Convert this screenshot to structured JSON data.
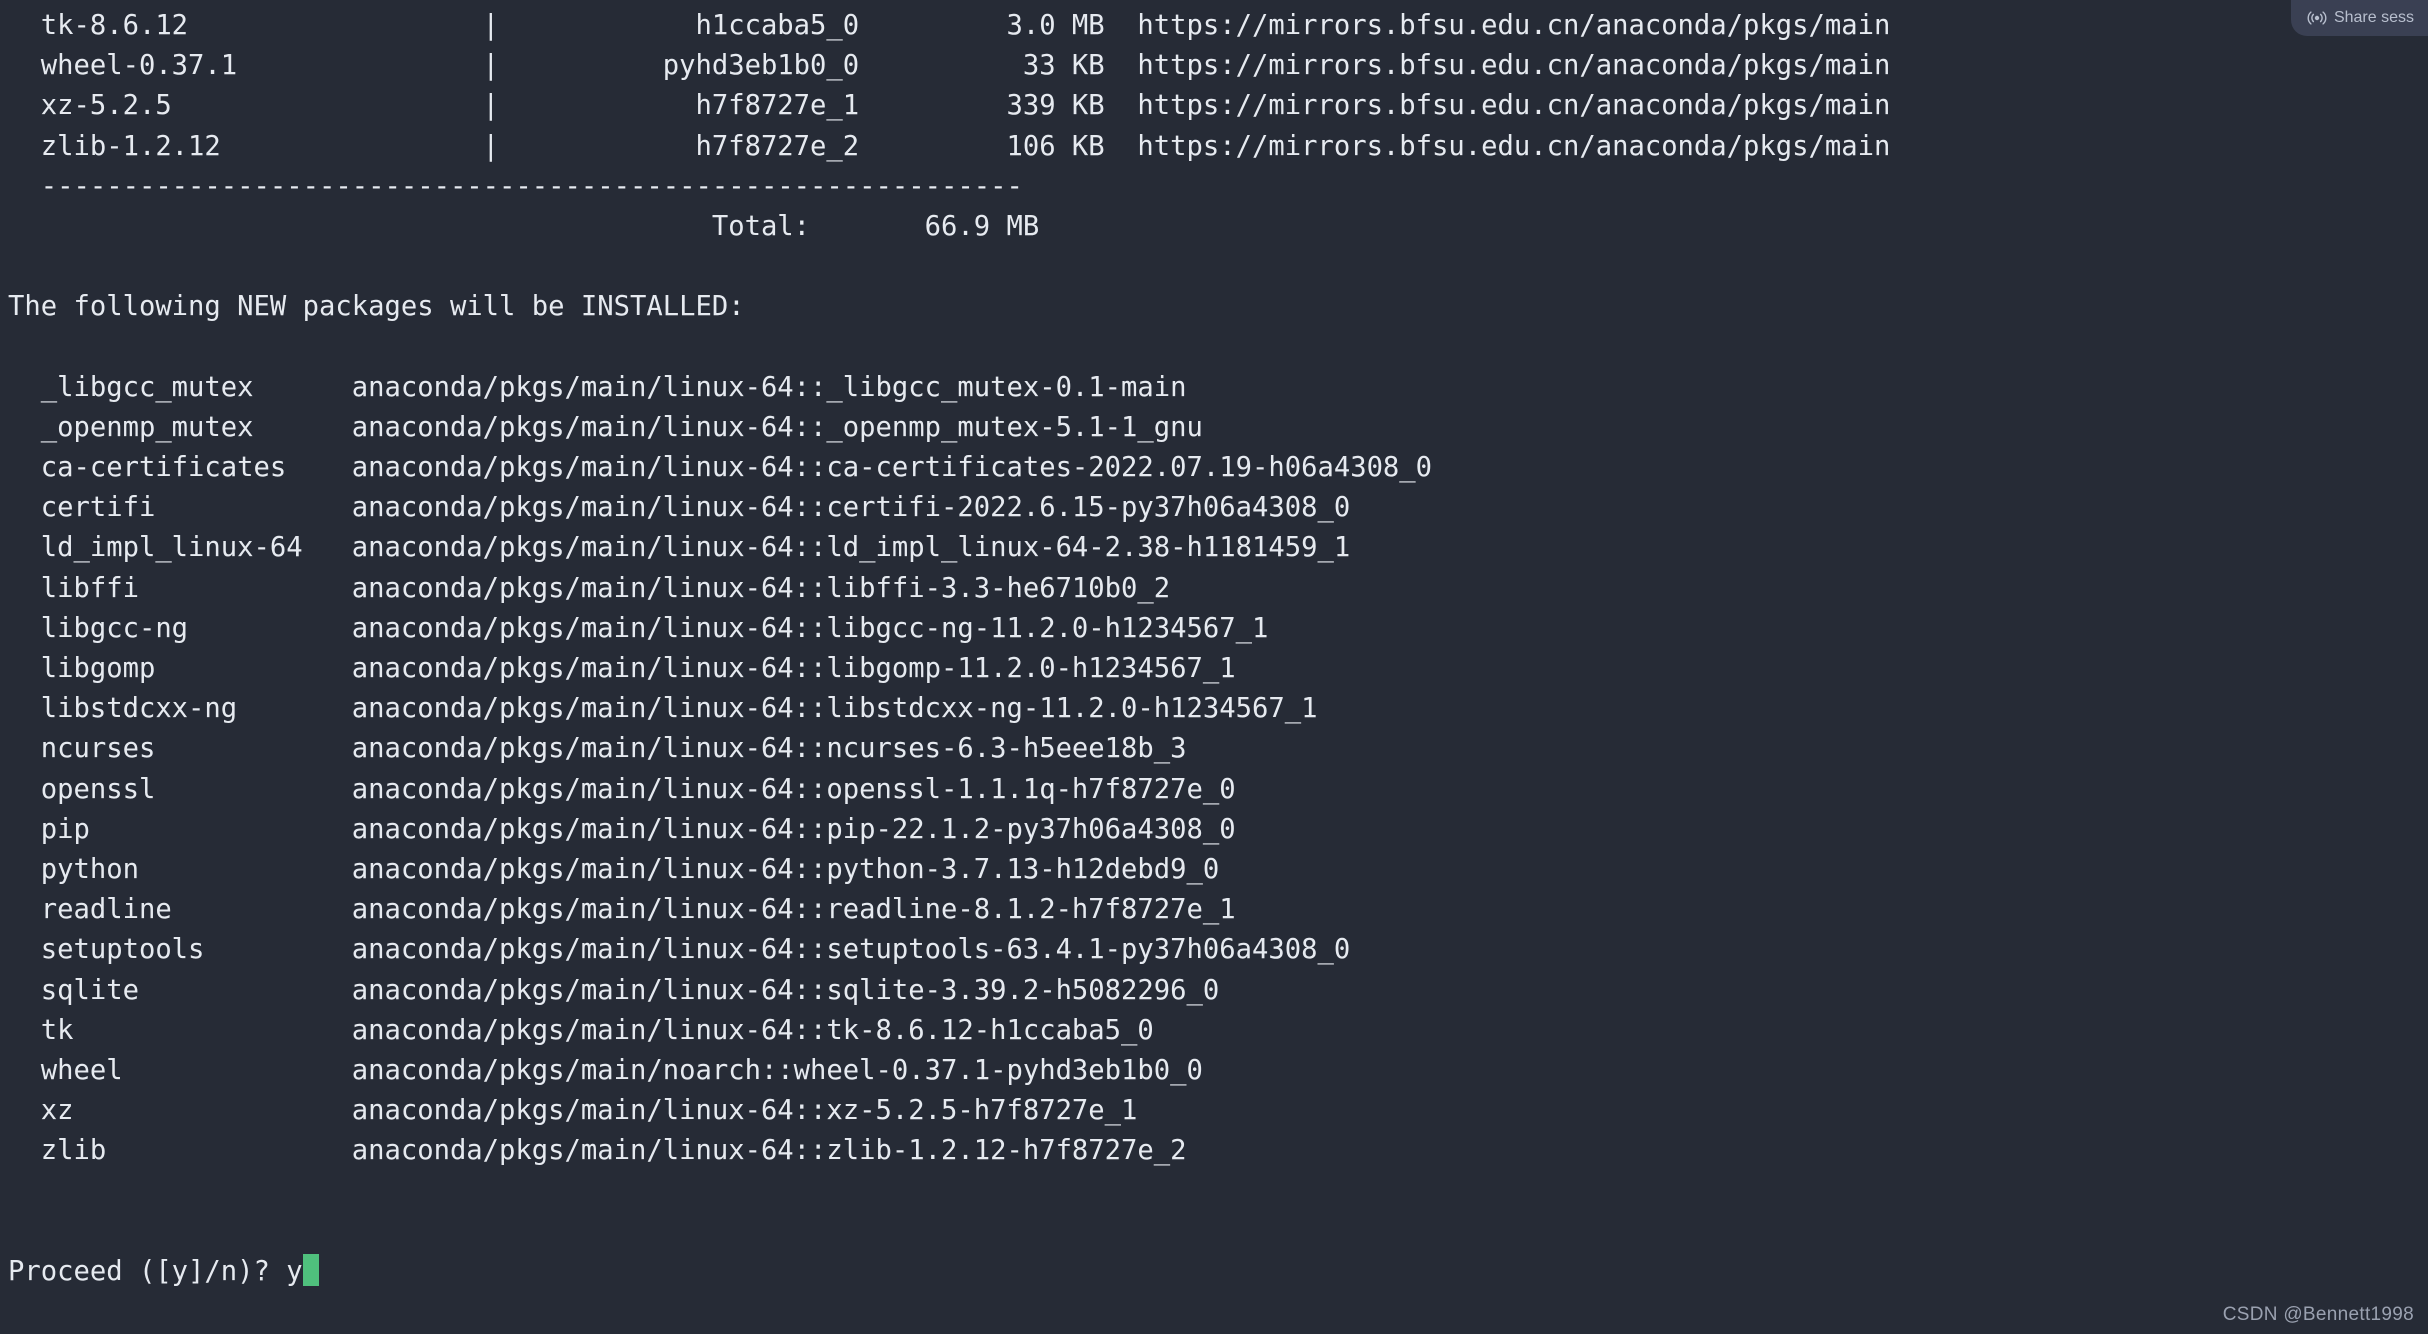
{
  "terminal": {
    "background_color": "#262b36",
    "text_color": "#e6eaf0",
    "cursor_color": "#4fc07d",
    "download_table": {
      "rows": [
        {
          "package": "  tk-8.6.12",
          "sep": "|",
          "build": "h1ccaba5_0",
          "size": "3.0 MB",
          "url": "https://mirrors.bfsu.edu.cn/anaconda/pkgs/main"
        },
        {
          "package": "  wheel-0.37.1",
          "sep": "|",
          "build": "pyhd3eb1b0_0",
          "size": "33 KB",
          "url": "https://mirrors.bfsu.edu.cn/anaconda/pkgs/main"
        },
        {
          "package": "  xz-5.2.5",
          "sep": "|",
          "build": "h7f8727e_1",
          "size": "339 KB",
          "url": "https://mirrors.bfsu.edu.cn/anaconda/pkgs/main"
        },
        {
          "package": "  zlib-1.2.12",
          "sep": "|",
          "build": "h7f8727e_2",
          "size": "106 KB",
          "url": "https://mirrors.bfsu.edu.cn/anaconda/pkgs/main"
        }
      ],
      "line_tk": "  tk-8.6.12                  |            h1ccaba5_0         3.0 MB  https://mirrors.bfsu.edu.cn/anaconda/pkgs/main",
      "line_wheel": "  wheel-0.37.1               |          pyhd3eb1b0_0          33 KB  https://mirrors.bfsu.edu.cn/anaconda/pkgs/main",
      "line_xz": "  xz-5.2.5                   |            h7f8727e_1         339 KB  https://mirrors.bfsu.edu.cn/anaconda/pkgs/main",
      "line_zlib": "  zlib-1.2.12                |            h7f8727e_2         106 KB  https://mirrors.bfsu.edu.cn/anaconda/pkgs/main",
      "separator": "  ------------------------------------------------------------",
      "total_line": "                                           Total:       66.9 MB",
      "total_label": "Total:",
      "total_value": "66.9 MB"
    },
    "install_header": "The following NEW packages will be INSTALLED:",
    "install_lines": [
      "  _libgcc_mutex      anaconda/pkgs/main/linux-64::_libgcc_mutex-0.1-main",
      "  _openmp_mutex      anaconda/pkgs/main/linux-64::_openmp_mutex-5.1-1_gnu",
      "  ca-certificates    anaconda/pkgs/main/linux-64::ca-certificates-2022.07.19-h06a4308_0",
      "  certifi            anaconda/pkgs/main/linux-64::certifi-2022.6.15-py37h06a4308_0",
      "  ld_impl_linux-64   anaconda/pkgs/main/linux-64::ld_impl_linux-64-2.38-h1181459_1",
      "  libffi             anaconda/pkgs/main/linux-64::libffi-3.3-he6710b0_2",
      "  libgcc-ng          anaconda/pkgs/main/linux-64::libgcc-ng-11.2.0-h1234567_1",
      "  libgomp            anaconda/pkgs/main/linux-64::libgomp-11.2.0-h1234567_1",
      "  libstdcxx-ng       anaconda/pkgs/main/linux-64::libstdcxx-ng-11.2.0-h1234567_1",
      "  ncurses            anaconda/pkgs/main/linux-64::ncurses-6.3-h5eee18b_3",
      "  openssl            anaconda/pkgs/main/linux-64::openssl-1.1.1q-h7f8727e_0",
      "  pip                anaconda/pkgs/main/linux-64::pip-22.1.2-py37h06a4308_0",
      "  python             anaconda/pkgs/main/linux-64::python-3.7.13-h12debd9_0",
      "  readline           anaconda/pkgs/main/linux-64::readline-8.1.2-h7f8727e_1",
      "  setuptools         anaconda/pkgs/main/linux-64::setuptools-63.4.1-py37h06a4308_0",
      "  sqlite             anaconda/pkgs/main/linux-64::sqlite-3.39.2-h5082296_0",
      "  tk                 anaconda/pkgs/main/linux-64::tk-8.6.12-h1ccaba5_0",
      "  wheel              anaconda/pkgs/main/noarch::wheel-0.37.1-pyhd3eb1b0_0",
      "  xz                 anaconda/pkgs/main/linux-64::xz-5.2.5-h7f8727e_1",
      "  zlib               anaconda/pkgs/main/linux-64::zlib-1.2.12-h7f8727e_2"
    ],
    "installed_packages": [
      {
        "name": "_libgcc_mutex",
        "spec": "anaconda/pkgs/main/linux-64::_libgcc_mutex-0.1-main"
      },
      {
        "name": "_openmp_mutex",
        "spec": "anaconda/pkgs/main/linux-64::_openmp_mutex-5.1-1_gnu"
      },
      {
        "name": "ca-certificates",
        "spec": "anaconda/pkgs/main/linux-64::ca-certificates-2022.07.19-h06a4308_0"
      },
      {
        "name": "certifi",
        "spec": "anaconda/pkgs/main/linux-64::certifi-2022.6.15-py37h06a4308_0"
      },
      {
        "name": "ld_impl_linux-64",
        "spec": "anaconda/pkgs/main/linux-64::ld_impl_linux-64-2.38-h1181459_1"
      },
      {
        "name": "libffi",
        "spec": "anaconda/pkgs/main/linux-64::libffi-3.3-he6710b0_2"
      },
      {
        "name": "libgcc-ng",
        "spec": "anaconda/pkgs/main/linux-64::libgcc-ng-11.2.0-h1234567_1"
      },
      {
        "name": "libgomp",
        "spec": "anaconda/pkgs/main/linux-64::libgomp-11.2.0-h1234567_1"
      },
      {
        "name": "libstdcxx-ng",
        "spec": "anaconda/pkgs/main/linux-64::libstdcxx-ng-11.2.0-h1234567_1"
      },
      {
        "name": "ncurses",
        "spec": "anaconda/pkgs/main/linux-64::ncurses-6.3-h5eee18b_3"
      },
      {
        "name": "openssl",
        "spec": "anaconda/pkgs/main/linux-64::openssl-1.1.1q-h7f8727e_0"
      },
      {
        "name": "pip",
        "spec": "anaconda/pkgs/main/linux-64::pip-22.1.2-py37h06a4308_0"
      },
      {
        "name": "python",
        "spec": "anaconda/pkgs/main/linux-64::python-3.7.13-h12debd9_0"
      },
      {
        "name": "readline",
        "spec": "anaconda/pkgs/main/linux-64::readline-8.1.2-h7f8727e_1"
      },
      {
        "name": "setuptools",
        "spec": "anaconda/pkgs/main/linux-64::setuptools-63.4.1-py37h06a4308_0"
      },
      {
        "name": "sqlite",
        "spec": "anaconda/pkgs/main/linux-64::sqlite-3.39.2-h5082296_0"
      },
      {
        "name": "tk",
        "spec": "anaconda/pkgs/main/linux-64::tk-8.6.12-h1ccaba5_0"
      },
      {
        "name": "wheel",
        "spec": "anaconda/pkgs/main/noarch::wheel-0.37.1-pyhd3eb1b0_0"
      },
      {
        "name": "xz",
        "spec": "anaconda/pkgs/main/linux-64::xz-5.2.5-h7f8727e_1"
      },
      {
        "name": "zlib",
        "spec": "anaconda/pkgs/main/linux-64::zlib-1.2.12-h7f8727e_2"
      }
    ],
    "prompt": {
      "text": "Proceed ([y]/n)? ",
      "typed_value": "y"
    }
  },
  "overlay": {
    "share_badge": {
      "label": "Share sess",
      "icon": "broadcast-icon",
      "background_color": "#3a4053",
      "text_color": "#b8bfce"
    },
    "watermark": "CSDN @Bennett1998"
  }
}
